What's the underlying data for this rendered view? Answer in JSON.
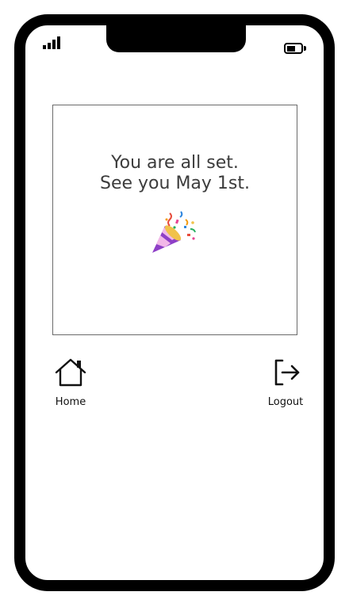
{
  "status_bar": {
    "signal_icon": "signal-bars-icon",
    "battery_icon": "battery-icon"
  },
  "card": {
    "line1": "You are all set.",
    "line2": "See you May 1st.",
    "emoji_icon": "party-popper-icon"
  },
  "nav": {
    "home_label": "Home",
    "home_icon": "home-icon",
    "logout_label": "Logout",
    "logout_icon": "logout-icon"
  }
}
